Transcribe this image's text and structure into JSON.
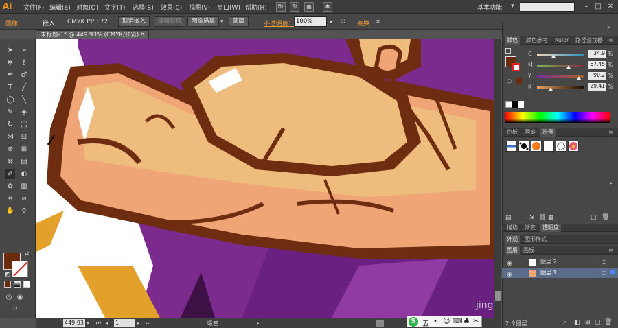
{
  "app": {
    "logo": "Ai",
    "workspace": "基本功能",
    "window_controls": [
      "–",
      "□",
      "✕"
    ]
  },
  "menu": [
    "文件(F)",
    "编辑(E)",
    "对象(O)",
    "文字(T)",
    "选择(S)",
    "效果(C)",
    "视图(V)",
    "窗口(W)",
    "帮助(H)"
  ],
  "control_bar": {
    "label": "图像",
    "embed_label": "嵌入",
    "info": "CMYK  PPI: 72",
    "unembed_button": "取消嵌入",
    "edit_original_button": "编辑原稿",
    "image_trace_button": "图像描摹",
    "mask_button": "蒙版",
    "opacity_label": "不透明度：",
    "opacity_value": "100%",
    "transform_label": "变换"
  },
  "document": {
    "tab_title": "未标题-1* @ 449.93% (CMYK/预览)",
    "close": "×"
  },
  "status": {
    "zoom": "449.93",
    "page": "1",
    "tool_text": "吸管"
  },
  "color_panel": {
    "tabs": [
      "颜色",
      "颜色参考",
      "Kuler",
      "路径查找器"
    ],
    "sliders": [
      {
        "label": "C",
        "value": "34.9",
        "fraction": 0.349,
        "gradient": "linear-gradient(to right, #f3d6b8, #2b8fbf)"
      },
      {
        "label": "M",
        "value": "67.45",
        "fraction": 0.6745,
        "gradient": "linear-gradient(to right, #7ab55a, #8a2a40)"
      },
      {
        "label": "Y",
        "value": "90.2",
        "fraction": 0.902,
        "gradient": "linear-gradient(to right, #7a2fa0, #a86020)"
      },
      {
        "label": "K",
        "value": "29.41",
        "fraction": 0.2941,
        "gradient": "linear-gradient(to right, #e8a060, #1a0a00)"
      }
    ],
    "percent": "%"
  },
  "swatch_panel": {
    "tabs": [
      "色板",
      "画笔",
      "符号"
    ]
  },
  "appearance_panel": {
    "tabs": [
      "描边",
      "渐变",
      "透明度"
    ]
  },
  "layers_panel": {
    "tabs": [
      "外观",
      "图形样式"
    ],
    "subtabs": [
      "图层",
      "画板"
    ],
    "layers": [
      {
        "name": "图层 2"
      },
      {
        "name": "图层 1"
      }
    ],
    "footer": "2 个图层"
  },
  "colors": {
    "fill": "#6b2b0e",
    "accent": "#f39c34",
    "purple": "#7b2a8e",
    "skin": "#eebc7c",
    "outline": "#6e2c10"
  }
}
